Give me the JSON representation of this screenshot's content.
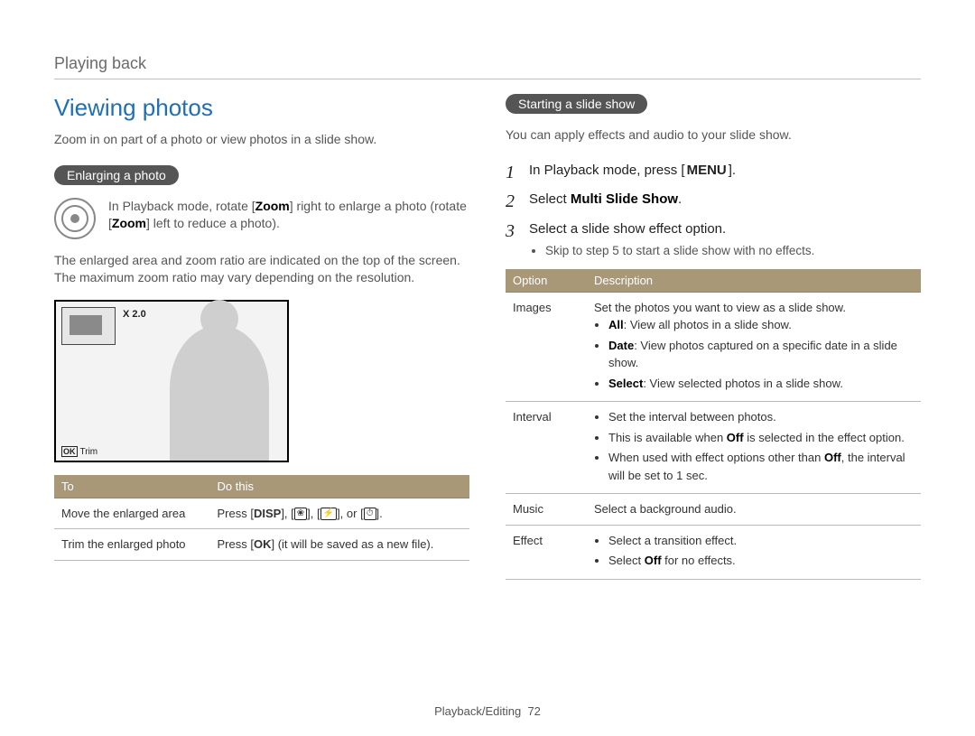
{
  "header": {
    "section": "Playing back"
  },
  "left": {
    "title": "Viewing photos",
    "intro": "Zoom in on part of a photo or view photos in a slide show.",
    "pill": "Enlarging a photo",
    "zoom_text_pre": "In Playback mode, rotate [",
    "zoom_text_b1": "Zoom",
    "zoom_text_mid": "] right to enlarge a photo (rotate [",
    "zoom_text_b2": "Zoom",
    "zoom_text_post": "] left to reduce a photo).",
    "para": "The enlarged area and zoom ratio are indicated on the top of the screen. The maximum zoom ratio may vary depending on the resolution.",
    "preview_ratio": "X 2.0",
    "preview_trim": "Trim",
    "table": {
      "headers": [
        "To",
        "Do this"
      ],
      "rows": [
        {
          "to": "Move the enlarged area",
          "do_pre": "Press [",
          "do_b": "DISP",
          "do_mid": "], [",
          "do_i1": "❀",
          "do_mid2": "], [",
          "do_i2": "⚡",
          "do_mid3": "], or [",
          "do_i3": "⏱",
          "do_post": "]."
        },
        {
          "to": "Trim the enlarged photo",
          "do_pre": "Press [",
          "do_b": "OK",
          "do_post": "] (it will be saved as a new file)."
        }
      ]
    }
  },
  "right": {
    "pill": "Starting a slide show",
    "intro": "You can apply effects and audio to your slide show.",
    "steps": [
      {
        "pre": "In Playback mode, press [",
        "b": "MENU",
        "post": "]."
      },
      {
        "pre": "Select ",
        "b": "Multi Slide Show",
        "post": "."
      },
      {
        "pre": "Select a slide show effect option.",
        "sub": [
          "Skip to step 5 to start a slide show with no effects."
        ]
      }
    ],
    "table": {
      "headers": [
        "Option",
        "Description"
      ],
      "rows": [
        {
          "opt": "Images",
          "lead": "Set the photos you want to view as a slide show.",
          "items": [
            {
              "b": "All",
              "t": ": View all photos in a slide show."
            },
            {
              "b": "Date",
              "t": ": View photos captured on a specific date in a slide show."
            },
            {
              "b": "Select",
              "t": ": View selected photos in a slide show."
            }
          ]
        },
        {
          "opt": "Interval",
          "items_plain": [
            "Set the interval between photos.",
            {
              "pre": "This is available when ",
              "b": "Off",
              "post": " is selected in the effect option."
            },
            {
              "pre": "When used with effect options other than ",
              "b": "Off",
              "post": ", the interval will be set to 1 sec."
            }
          ]
        },
        {
          "opt": "Music",
          "plain": "Select a background audio."
        },
        {
          "opt": "Effect",
          "items_plain": [
            "Select a transition effect.",
            {
              "pre": "Select ",
              "b": "Off",
              "post": " for no effects."
            }
          ]
        }
      ]
    }
  },
  "footer": {
    "section": "Playback/Editing",
    "page": "72"
  }
}
